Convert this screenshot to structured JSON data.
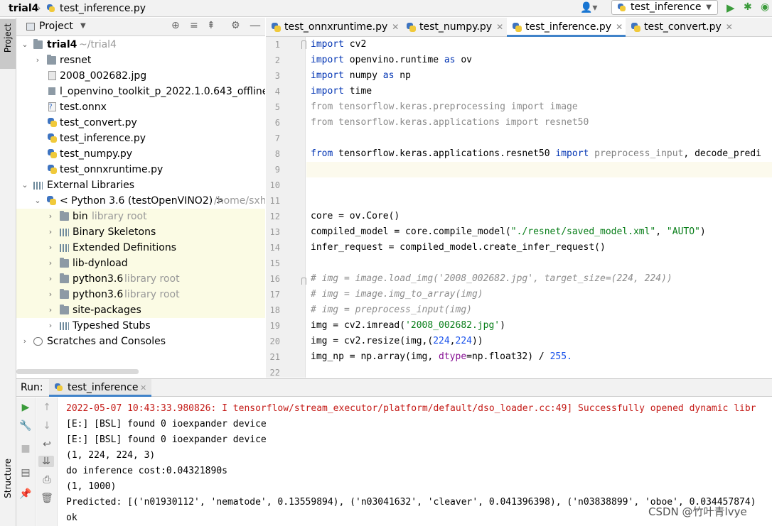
{
  "breadcrumb": {
    "project": "trial4",
    "file": "test_inference.py"
  },
  "toolbar": {
    "run_config": "test_inference",
    "run_icon": "play-icon",
    "debug_icon": "bug-icon"
  },
  "left_strip": {
    "project_tab": "Project",
    "structure_tab": "Structure"
  },
  "project_panel": {
    "title": "Project"
  },
  "tree": {
    "root": {
      "name": "trial4",
      "path": "~/trial4"
    },
    "items": [
      {
        "label": "resnet"
      },
      {
        "label": "2008_002682.jpg"
      },
      {
        "label": "l_openvino_toolkit_p_2022.1.0.643_offline."
      },
      {
        "label": "test.onnx"
      },
      {
        "label": "test_convert.py"
      },
      {
        "label": "test_inference.py"
      },
      {
        "label": "test_numpy.py"
      },
      {
        "label": "test_onnxruntime.py"
      }
    ],
    "external": "External Libraries",
    "python": {
      "name": "< Python 3.6 (testOpenVINO2) >",
      "path": "/home/sxh"
    },
    "libs": [
      {
        "label": "bin",
        "note": "library root"
      },
      {
        "label": "Binary Skeletons",
        "note": ""
      },
      {
        "label": "Extended Definitions",
        "note": ""
      },
      {
        "label": "lib-dynload",
        "note": ""
      },
      {
        "label": "python3.6",
        "note": "library root"
      },
      {
        "label": "python3.6",
        "note": "library root"
      },
      {
        "label": "site-packages",
        "note": ""
      },
      {
        "label": "Typeshed Stubs",
        "note": ""
      }
    ],
    "scratches": "Scratches and Consoles"
  },
  "editor_tabs": [
    {
      "label": "test_onnxruntime.py"
    },
    {
      "label": "test_numpy.py"
    },
    {
      "label": "test_inference.py"
    },
    {
      "label": "test_convert.py"
    }
  ],
  "code": {
    "line_numbers": [
      "1",
      "2",
      "3",
      "4",
      "5",
      "6",
      "7",
      "8",
      "9",
      "10",
      "11",
      "12",
      "13",
      "14",
      "15",
      "16",
      "17",
      "18",
      "19",
      "20",
      "21",
      "22"
    ],
    "l1": {
      "kw": "import",
      "rest": " cv2"
    },
    "l2": {
      "kw": "import",
      "a": " openvino.runtime ",
      "kw2": "as",
      "b": " ov"
    },
    "l3": {
      "kw": "import",
      "a": " numpy ",
      "kw2": "as",
      "b": " np"
    },
    "l4": {
      "kw": "import",
      "rest": " time"
    },
    "l5": "from tensorflow.keras.preprocessing import image",
    "l6": "from tensorflow.keras.applications import resnet50",
    "l8": {
      "kw": "from",
      "a": " tensorflow.keras.applications.resnet50 ",
      "kw2": "import",
      "b": " preprocess_input",
      "c": ", decode_predi"
    },
    "l12": "core = ov.Core()",
    "l13": {
      "a": "compiled_model = core.compile_model(",
      "s1": "\"./resnet/saved_model.xml\"",
      "b": ", ",
      "s2": "\"AUTO\"",
      "c": ")"
    },
    "l14": "infer_request = compiled_model.create_infer_request()",
    "l16": "# img = image.load_img('2008_002682.jpg', target_size=(224, 224))",
    "l17": "# img = image.img_to_array(img)",
    "l18": "# img = preprocess_input(img)",
    "l19": {
      "a": "img = cv2.imread(",
      "s": "'2008_002682.jpg'",
      "b": ")"
    },
    "l20": {
      "a": "img = cv2.resize(img,(",
      "n1": "224",
      "b": ",",
      "n2": "224",
      "c": "))"
    },
    "l21": {
      "a": "img_np = np.array(img, ",
      "p": "dtype",
      "b": "=np.float32) / ",
      "n": "255."
    }
  },
  "run_panel": {
    "label": "Run:",
    "tab": "test_inference",
    "lines": [
      "2022-05-07 10:43:33.980826: I tensorflow/stream_executor/platform/default/dso_loader.cc:49] Successfully opened dynamic libr",
      "[E:] [BSL] found 0 ioexpander device",
      "[E:] [BSL] found 0 ioexpander device",
      "(1, 224, 224, 3)",
      "do inference cost:0.04321890s",
      "(1, 1000)",
      "Predicted: [('n01930112', 'nematode', 0.13559894), ('n03041632', 'cleaver', 0.041396398), ('n03838899', 'oboe', 0.034457874)",
      "ok"
    ]
  },
  "watermark": "CSDN @竹叶青lvye"
}
